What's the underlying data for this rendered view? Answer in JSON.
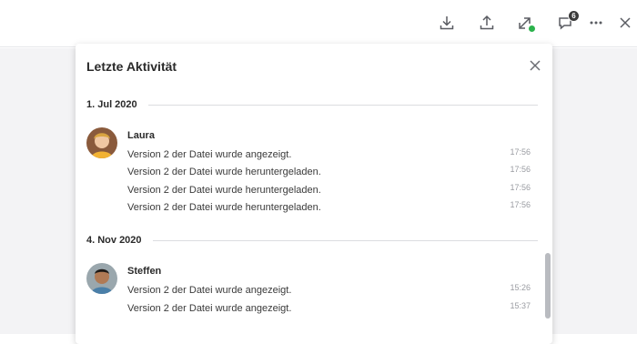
{
  "toolbar": {
    "download_icon": "download-icon",
    "upload_icon": "upload-icon",
    "share_icon": "share-icon",
    "comments_icon": "comments-icon",
    "comments_count": "6",
    "more_icon": "more-icon",
    "close_icon": "close-icon"
  },
  "panel": {
    "title": "Letzte Aktivität",
    "groups": [
      {
        "date": "1. Jul 2020",
        "user": "Laura",
        "entries": [
          {
            "text": "Version 2 der Datei wurde angezeigt.",
            "time": "17:56"
          },
          {
            "text": "Version 2 der Datei wurde heruntergeladen.",
            "time": "17:56"
          },
          {
            "text": "Version 2 der Datei wurde heruntergeladen.",
            "time": "17:56"
          },
          {
            "text": "Version 2 der Datei wurde heruntergeladen.",
            "time": "17:56"
          }
        ]
      },
      {
        "date": "4. Nov 2020",
        "user": "Steffen",
        "entries": [
          {
            "text": "Version 2 der Datei wurde angezeigt.",
            "time": "15:26"
          },
          {
            "text": "Version 2 der Datei wurde angezeigt.",
            "time": "15:37"
          }
        ]
      }
    ]
  },
  "colors": {
    "accent_green": "#2bb24c",
    "badge_bg": "#3a3a3a",
    "muted_text": "#9a9ca2"
  }
}
